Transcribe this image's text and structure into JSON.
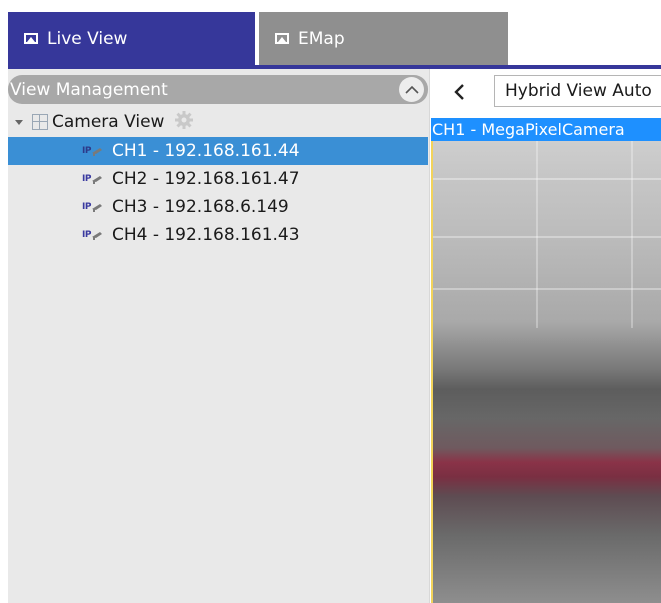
{
  "tabs": [
    {
      "label": "Live View",
      "icon": "image-icon",
      "active": true
    },
    {
      "label": "EMap",
      "icon": "image-icon",
      "active": false
    }
  ],
  "view_management": {
    "title": "View Management",
    "toggle_icon": "chevron-up-icon",
    "root": {
      "label": "Camera View",
      "icon": "grid-icon",
      "settings_icon": "gear-icon"
    },
    "channels": [
      {
        "label": "CH1 - 192.168.161.44",
        "badge": "IP",
        "selected": true
      },
      {
        "label": "CH2 - 192.168.161.47",
        "badge": "IP",
        "selected": false
      },
      {
        "label": "CH3 - 192.168.6.149",
        "badge": "IP",
        "selected": false
      },
      {
        "label": "CH4 - 192.168.161.43",
        "badge": "IP",
        "selected": false
      }
    ]
  },
  "live_area": {
    "back_icon": "chevron-left-icon",
    "view_select": "Hybrid View Auto",
    "camera_label": "CH1 - MegaPixelCamera"
  },
  "colors": {
    "accent": "#36379a",
    "tab_inactive": "#8f8f8f",
    "selection": "#3a8fd5",
    "camera_label_bg": "#1e90ff"
  }
}
